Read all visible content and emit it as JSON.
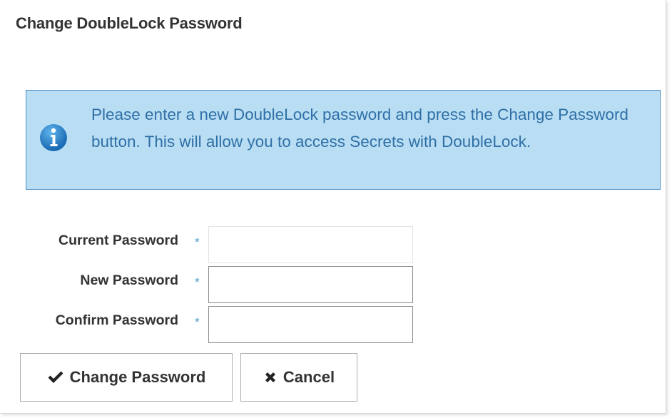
{
  "dialog": {
    "title": "Change DoubleLock Password"
  },
  "info": {
    "icon": "info-icon",
    "message": "Please enter a new DoubleLock password and press the Change Password button. This will allow you to access Secrets with DoubleLock."
  },
  "form": {
    "fields": [
      {
        "label": "Current Password",
        "required_marker": "*",
        "value": ""
      },
      {
        "label": "New Password",
        "required_marker": "*",
        "value": ""
      },
      {
        "label": "Confirm Password",
        "required_marker": "*",
        "value": ""
      }
    ]
  },
  "buttons": {
    "change_label": "Change Password",
    "change_icon": "check-icon",
    "cancel_label": "Cancel",
    "cancel_icon": "x-icon"
  },
  "colors": {
    "info_background": "#b9def4",
    "info_border": "#4a90c4",
    "info_text": "#2f6fa6",
    "required_marker": "#4a9ad4",
    "icon_blue": "#1f78c8"
  }
}
